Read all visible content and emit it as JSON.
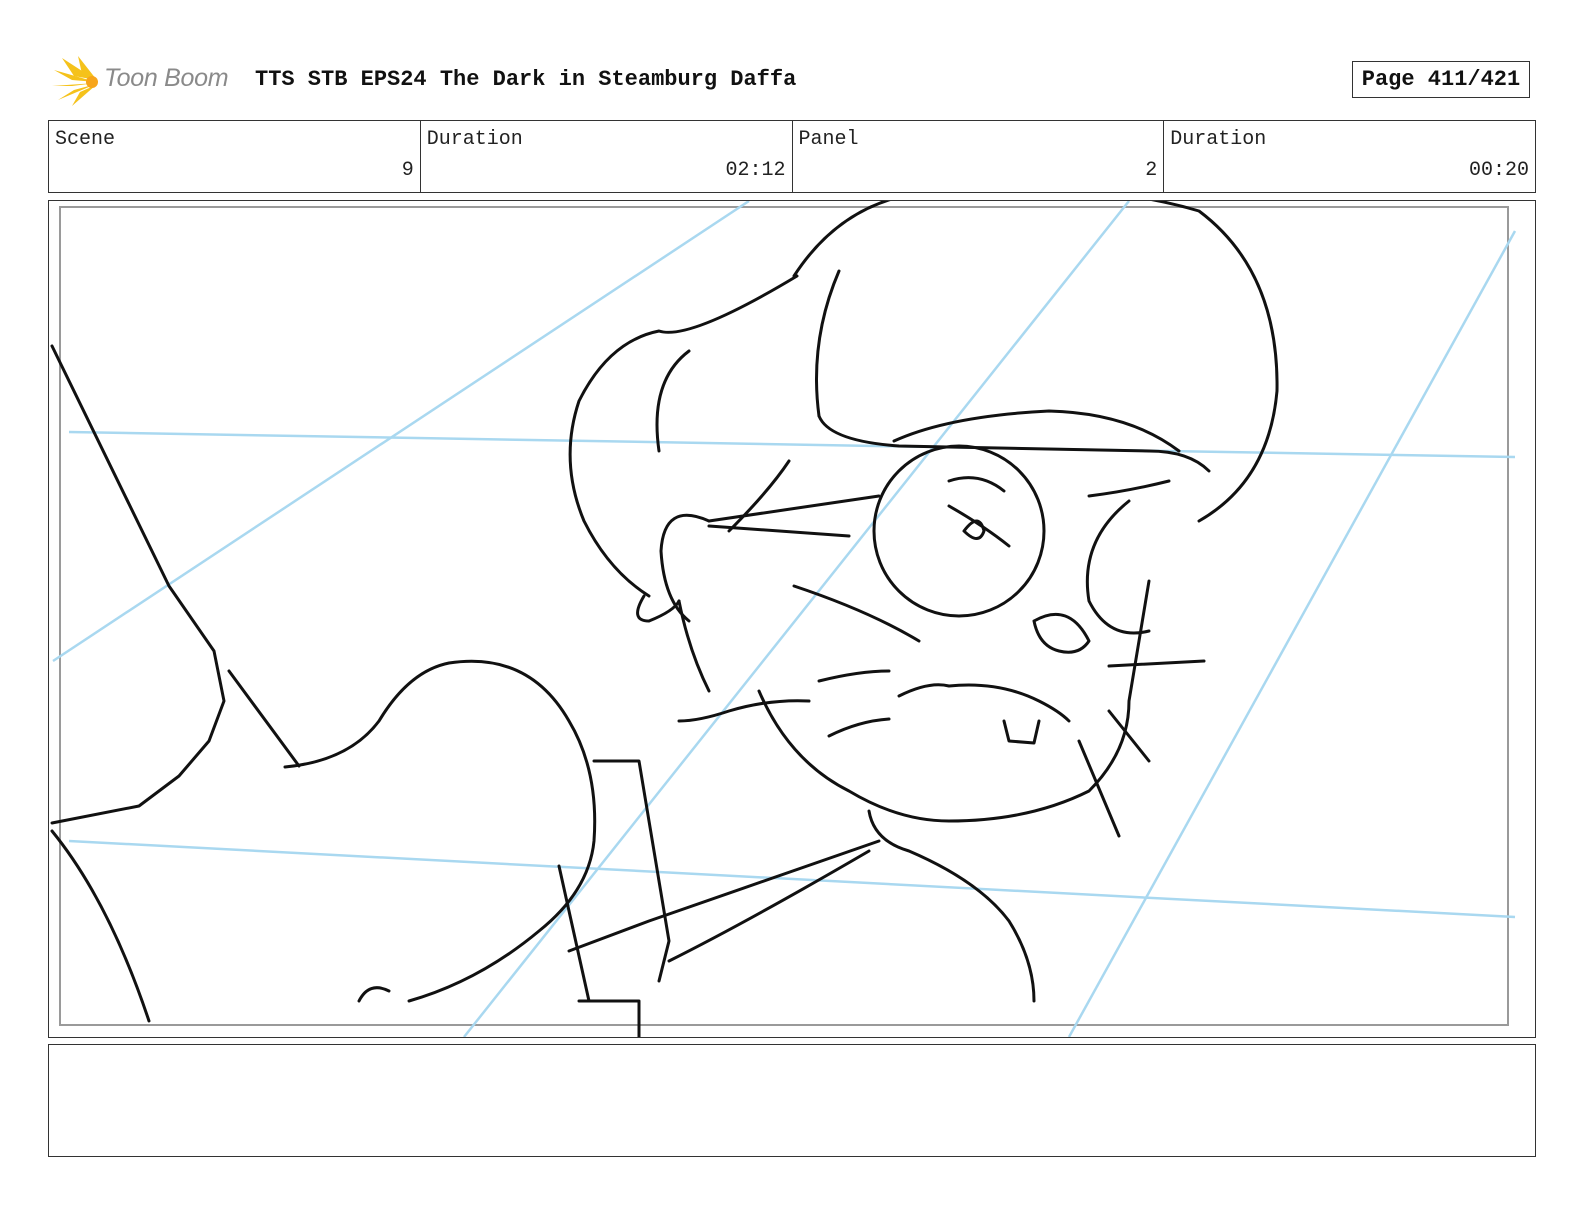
{
  "header": {
    "logo_text": "Toon Boom",
    "title": "TTS STB EPS24 The Dark in Steamburg Daffa",
    "page_label": "Page 411/421"
  },
  "info": {
    "scene_label": "Scene",
    "scene_value": "9",
    "scene_duration_label": "Duration",
    "scene_duration_value": "02:12",
    "panel_label": "Panel",
    "panel_value": "2",
    "panel_duration_label": "Duration",
    "panel_duration_value": "00:20"
  },
  "colors": {
    "sketch_ink": "#111111",
    "guide_lines": "#a9d8f0",
    "logo_burst": "#f5c21b",
    "border": "#333333"
  },
  "icons": {
    "logo": "toon-boom-burst-icon"
  }
}
